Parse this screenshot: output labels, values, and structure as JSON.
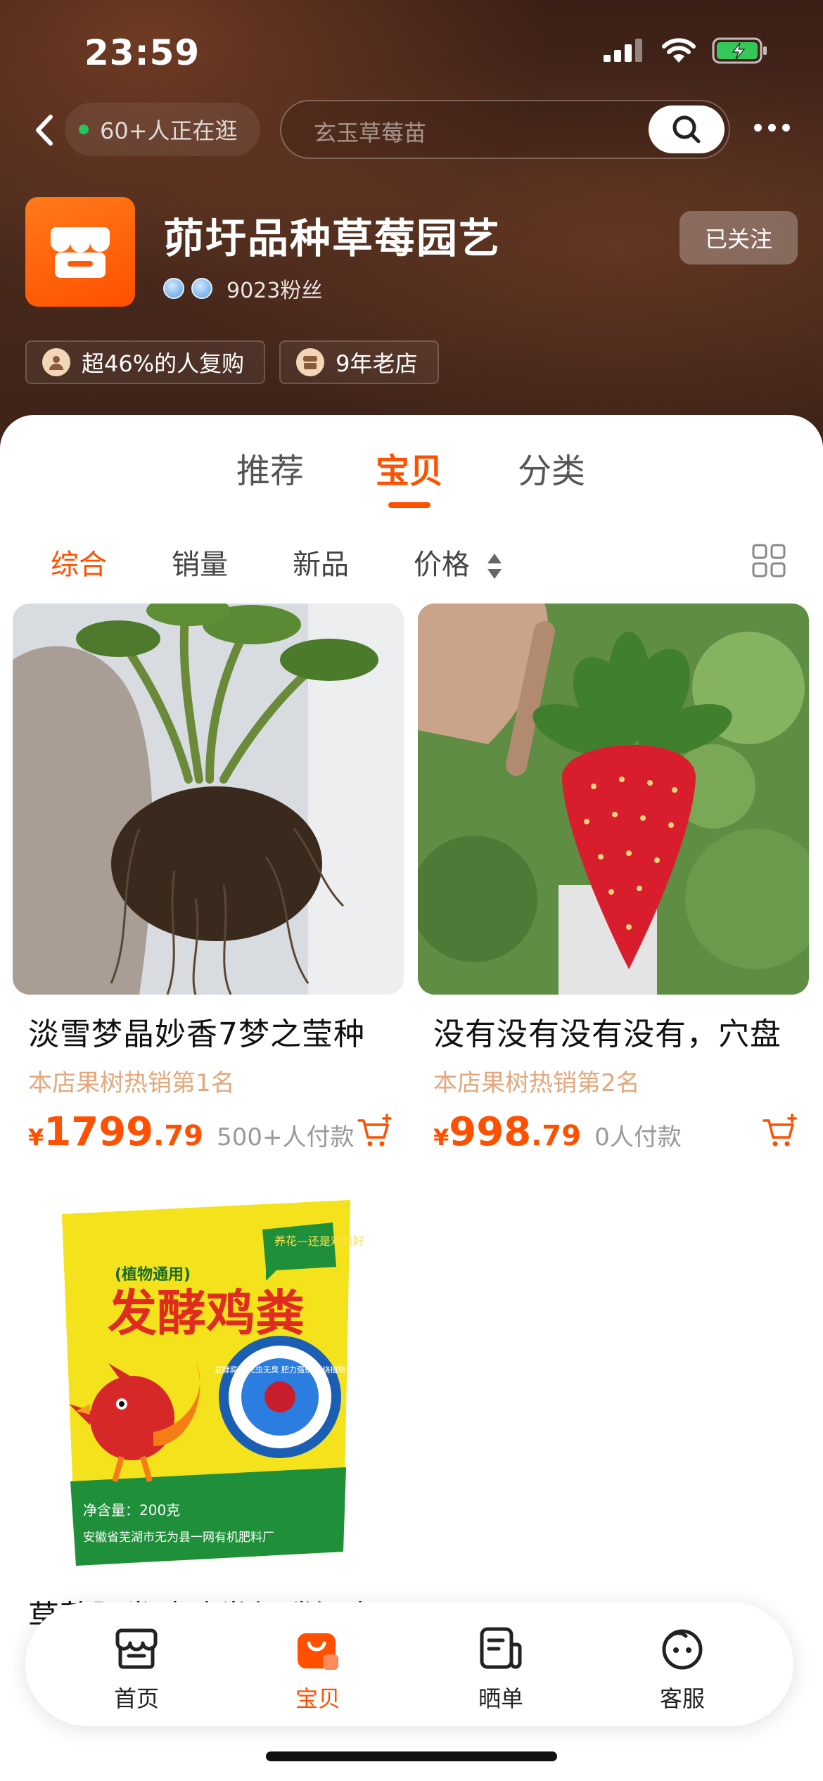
{
  "status_bar": {
    "time": "23:59"
  },
  "header": {
    "live_viewers": "60+人正在逛",
    "search_placeholder": "玄玉草莓苗",
    "shop_name": "茆圩品种草莓园艺",
    "fans": "9023粉丝",
    "follow_label": "已关注",
    "tags": [
      "超46%的人复购",
      "9年老店"
    ]
  },
  "tabs": {
    "items": [
      "推荐",
      "宝贝",
      "分类"
    ],
    "active": "宝贝"
  },
  "sort": {
    "items": [
      "综合",
      "销量",
      "新品",
      "价格"
    ],
    "active": "综合"
  },
  "products": [
    {
      "title": "淡雪梦晶妙香7梦之莹种",
      "rank": "本店果树热销第1名",
      "currency": "¥",
      "price_int": "1799",
      "price_dec": ".79",
      "sold": "500+人付款"
    },
    {
      "title": "没有没有没有没有，穴盘",
      "rank": "本店果树热销第2名",
      "currency": "¥",
      "price_int": "998",
      "price_dec": ".79",
      "sold": "0人付款"
    },
    {
      "title": "草莓肥发酵鸡粪氮磷钾大",
      "package_text": {
        "tag": "(植物通用)",
        "name": "发酵鸡粪",
        "bubble": "养花—还是鸡粪好",
        "seal": "发酵腐熟 无虫无臭 肥力强劲 不烧植物",
        "net": "净含量：200克",
        "maker": "安徽省芜湖市无为县一网有机肥料厂"
      }
    }
  ],
  "bottom_nav": {
    "items": [
      {
        "label": "首页",
        "icon": "shop-icon"
      },
      {
        "label": "宝贝",
        "icon": "bag-icon"
      },
      {
        "label": "晒单",
        "icon": "review-icon"
      },
      {
        "label": "客服",
        "icon": "service-icon"
      }
    ],
    "active": "宝贝"
  },
  "colors": {
    "accent": "#ff5000",
    "header_bg": "#3e2318",
    "rank_text": "#e3a77c"
  }
}
